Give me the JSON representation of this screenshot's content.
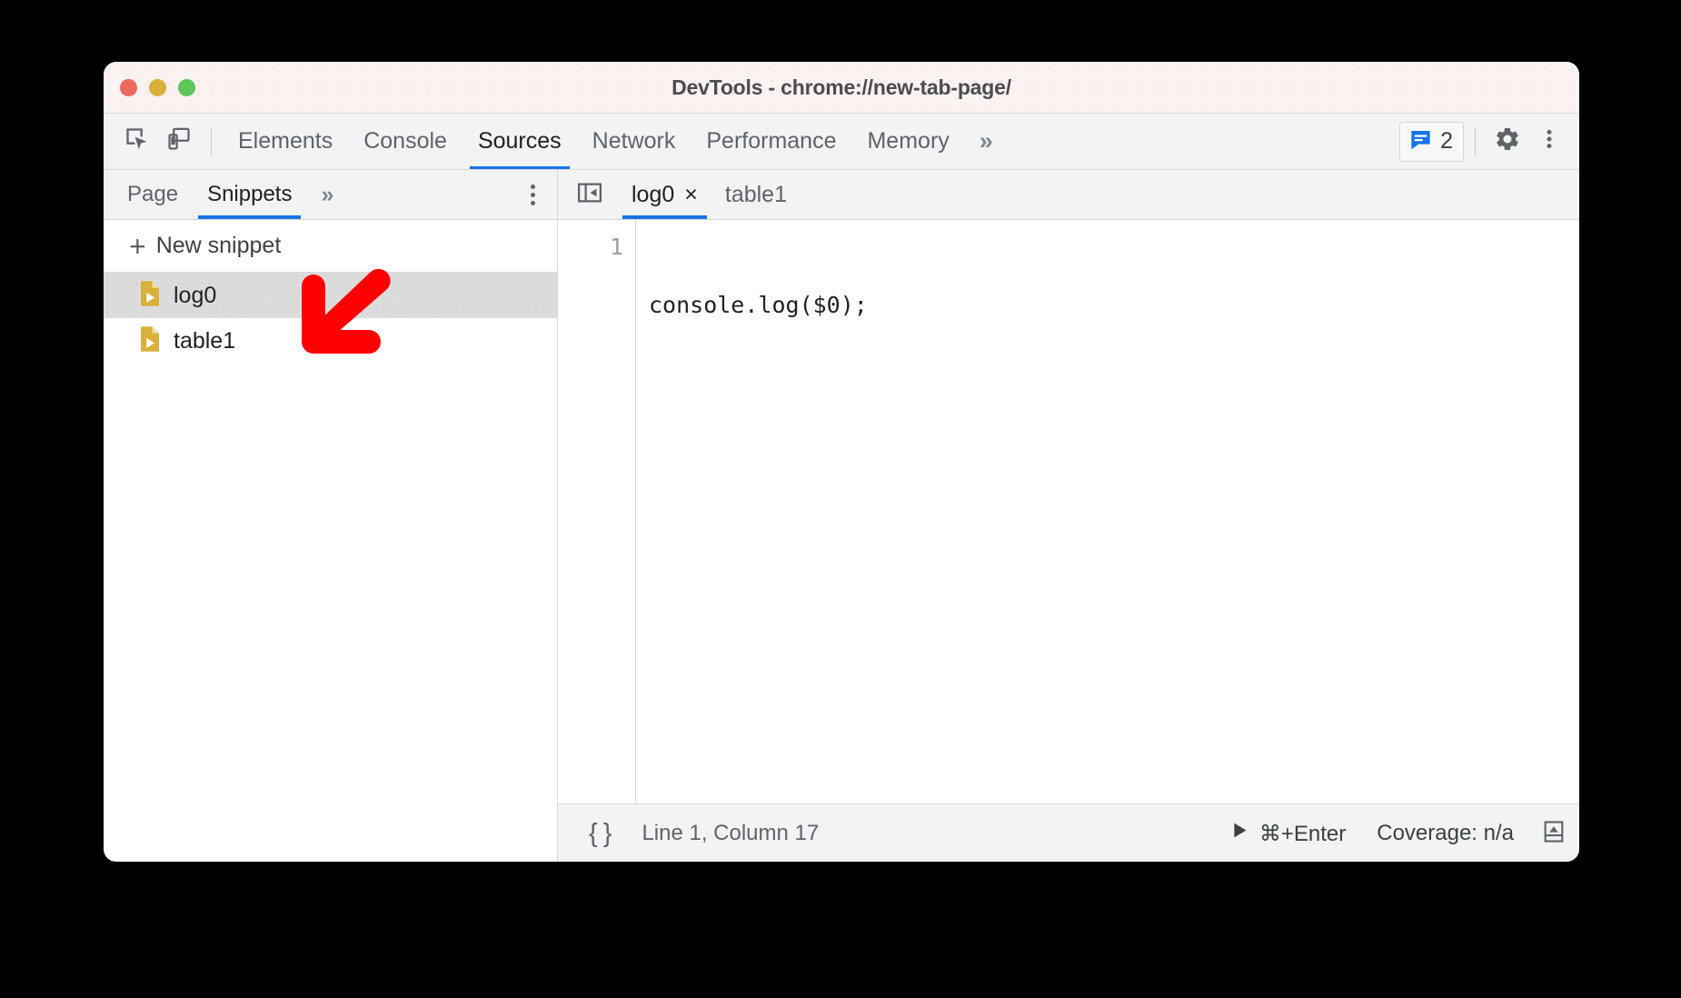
{
  "window": {
    "title": "DevTools - chrome://new-tab-page/",
    "traffic_lights": [
      "close",
      "minimize",
      "zoom"
    ],
    "colors": {
      "titlebar_bg": "#fbf2f2",
      "toolbar_bg": "#f1f3f4",
      "accent_blue": "#1a73e8",
      "selected_row": "#dcdcdc",
      "snippet_icon": "#d9b13a",
      "annotation_red": "#ff0000",
      "traffic_red": "#ed6a5f",
      "traffic_yellow": "#d9b13a",
      "traffic_green": "#5fc65a"
    }
  },
  "toolbar": {
    "inspect_icon": "inspect-element-icon",
    "device_icon": "device-toolbar-icon",
    "tabs": [
      {
        "label": "Elements",
        "active": false
      },
      {
        "label": "Console",
        "active": false
      },
      {
        "label": "Sources",
        "active": true
      },
      {
        "label": "Network",
        "active": false
      },
      {
        "label": "Performance",
        "active": false
      },
      {
        "label": "Memory",
        "active": false
      }
    ],
    "more_tabs_glyph": "»",
    "message_badge": {
      "icon": "console-message-icon",
      "count": "2"
    },
    "settings_icon": "gear-icon",
    "more_options_icon": "kebab-menu-icon"
  },
  "sidebar": {
    "tabs": [
      {
        "label": "Page",
        "active": false
      },
      {
        "label": "Snippets",
        "active": true
      }
    ],
    "more_tabs_glyph": "»",
    "more_options_icon": "kebab-menu-icon",
    "new_snippet": {
      "plus": "+",
      "label": "New snippet"
    },
    "snippets": [
      {
        "name": "log0",
        "selected": true
      },
      {
        "name": "table1",
        "selected": false
      }
    ]
  },
  "editor": {
    "collapse_icon": "collapse-sidebar-icon",
    "tabs": [
      {
        "label": "log0",
        "active": true,
        "close": "×"
      },
      {
        "label": "table1",
        "active": false,
        "close": ""
      }
    ],
    "lines": [
      {
        "number": "1",
        "text": "console.log($0);"
      }
    ]
  },
  "statusbar": {
    "format_button": "{ }",
    "cursor_position": "Line 1, Column 17",
    "run_icon": "play-icon",
    "run_shortcut": "⌘+Enter",
    "coverage": "Coverage: n/a",
    "drawer_icon": "show-drawer-icon"
  },
  "annotation": {
    "type": "arrow",
    "direction": "down-left",
    "color": "#ff0000",
    "points_at": "log0 snippet row"
  }
}
